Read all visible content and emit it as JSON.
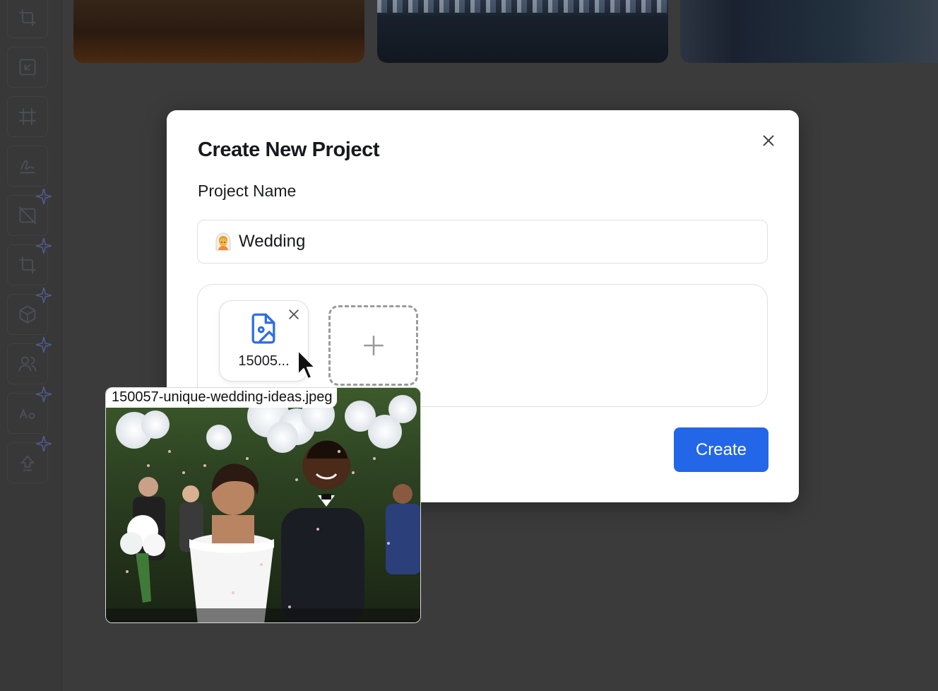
{
  "modal": {
    "title": "Create New Project",
    "field_label": "Project Name",
    "project_name": "Wedding",
    "project_emoji": "bride-with-veil",
    "file_chip_label": "15005...",
    "create_label": "Create"
  },
  "drag_preview": {
    "filename": "150057-unique-wedding-ideas.jpeg"
  },
  "toolbar": {
    "tools": [
      {
        "icon": "crop-icon",
        "ai": false
      },
      {
        "icon": "external-link-icon",
        "ai": false
      },
      {
        "icon": "frame-icon",
        "ai": false
      },
      {
        "icon": "signature-icon",
        "ai": false
      },
      {
        "icon": "remove-background-icon",
        "ai": true
      },
      {
        "icon": "smart-crop-icon",
        "ai": true
      },
      {
        "icon": "cube-icon",
        "ai": true
      },
      {
        "icon": "users-icon",
        "ai": true
      },
      {
        "icon": "text-style-icon",
        "ai": true
      },
      {
        "icon": "upscale-icon",
        "ai": true
      }
    ]
  },
  "colors": {
    "primary": "#2466e8",
    "background": "#3b3b3b",
    "file_icon": "#2e6de4"
  }
}
